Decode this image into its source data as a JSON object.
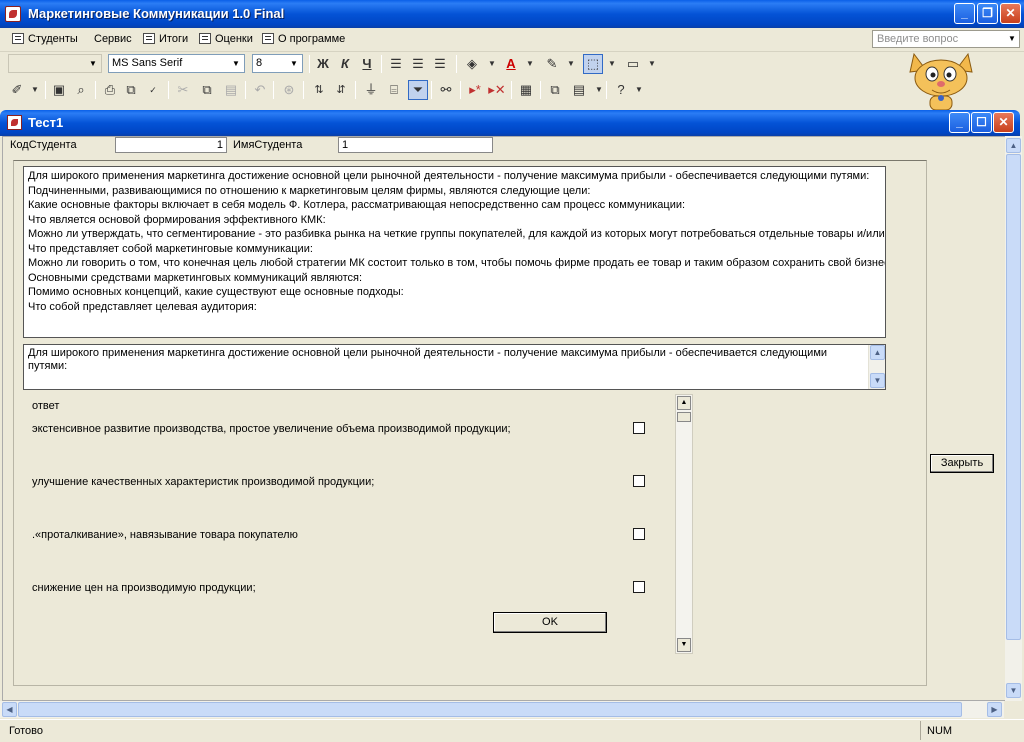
{
  "app": {
    "title": "Маркетинговые Коммуникации 1.0 Final",
    "accent": "#0453d6"
  },
  "window_controls": {
    "minimize": "_",
    "restore": "❐",
    "close": "✕"
  },
  "menu": {
    "items": [
      {
        "label": "Студенты",
        "icon": "table-icon"
      },
      {
        "label": "Сервис",
        "icon": null
      },
      {
        "label": "Итоги",
        "icon": "table-icon"
      },
      {
        "label": "Оценки",
        "icon": "table-icon"
      },
      {
        "label": "О программе",
        "icon": "table-icon"
      }
    ],
    "ask_placeholder": "Введите вопрос"
  },
  "format_toolbar": {
    "object_combo": "",
    "font": "MS Sans Serif",
    "font_size": "8",
    "bold": "Ж",
    "italic": "К",
    "underline": "Ч"
  },
  "child": {
    "title": "Тест1",
    "student_code_label": "КодСтудента",
    "student_code_value": "1",
    "student_name_label": "ИмяСтудента",
    "student_name_value": "1"
  },
  "questions": [
    "Для широкого применения маркетинга достижение основной цели рыночной деятельности - получение максимума прибыли - обеспечивается следующими путями:",
    "Подчиненными, развивающимися по отношению к маркетинговым целям фирмы, являются  следующие цели:",
    "Какие основные факторы включает в себя модель Ф. Котлера, рассматривающая непосредственно сам процесс коммуникации:",
    "Что является основой формирования эффективного КМК:",
    "Можно ли утверждать, что сегментирование - это разбивка рынка на четкие группы покупателей, для каждой из которых могут потребоваться отдельные товары и/или",
    "Что представляет собой маркетинговые коммуникации:",
    "Можно ли говорить о том, что конечная цель любой стратегии МК состоит только в том, чтобы помочь фирме продать ее товар и таким образом сохранить свой бизнес",
    "Основными средствами маркетинговых коммуникаций являются:",
    "Помимо основных концепций,  какие существуют еще основные подходы:",
    "Что собой представляет целевая аудитория:"
  ],
  "current_question": "Для широкого применения маркетинга достижение основной цели рыночной деятельности - получение максимума прибыли - обеспечивается следующими путями:",
  "answers_header": "ответ",
  "answers": [
    {
      "text": "экстенсивное развитие производства, простое увеличение объема производимой продукции;",
      "checked": false
    },
    {
      "text": "улучшение качественных характеристик производимой продукции;",
      "checked": false
    },
    {
      "text": ".«проталкивание», навязывание товара покупателю",
      "checked": false
    },
    {
      "text": "снижение цен на производимую продукции;",
      "checked": false
    }
  ],
  "buttons": {
    "ok": "OK",
    "close": "Закрыть"
  },
  "status": {
    "left": "Готово",
    "right": "NUM"
  }
}
